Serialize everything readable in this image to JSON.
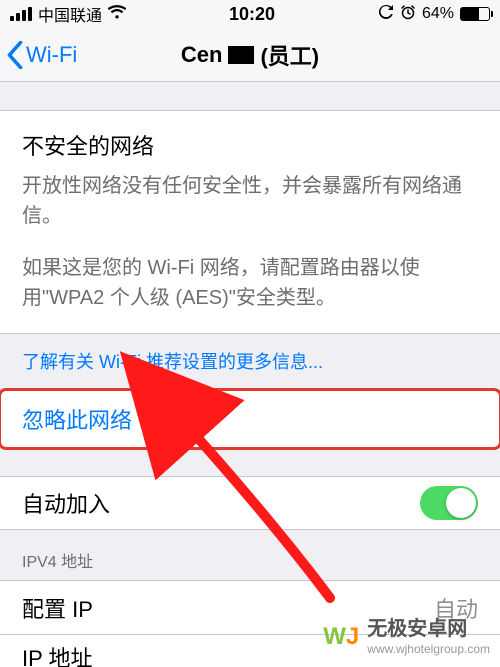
{
  "status": {
    "carrier": "中国联通",
    "time": "10:20",
    "battery_pct": "64%",
    "battery_fill_pct": 64
  },
  "nav": {
    "back_label": "Wi-Fi",
    "title_prefix": "Cen",
    "title_suffix": "(员工)"
  },
  "warning": {
    "heading": "不安全的网络",
    "body1": "开放性网络没有任何安全性，并会暴露所有网络通信。",
    "body2": "如果这是您的 Wi-Fi 网络，请配置路由器以使用\"WPA2 个人级 (AES)\"安全类型。"
  },
  "learn_more": "了解有关 Wi-Fi 推荐设置的更多信息...",
  "forget_label": "忽略此网络",
  "auto_join": {
    "label": "自动加入",
    "on": true
  },
  "ipv4": {
    "header": "IPV4 地址",
    "configure_label": "配置 IP",
    "configure_value_partial": "自动",
    "ip_label_partial": "IP 地址"
  },
  "watermark": {
    "brand": "无极安卓网",
    "url": "www.wjhotelgroup.com"
  },
  "colors": {
    "ios_blue": "#007aff",
    "ios_green": "#4cd964",
    "highlight_red": "#e03a2f"
  }
}
